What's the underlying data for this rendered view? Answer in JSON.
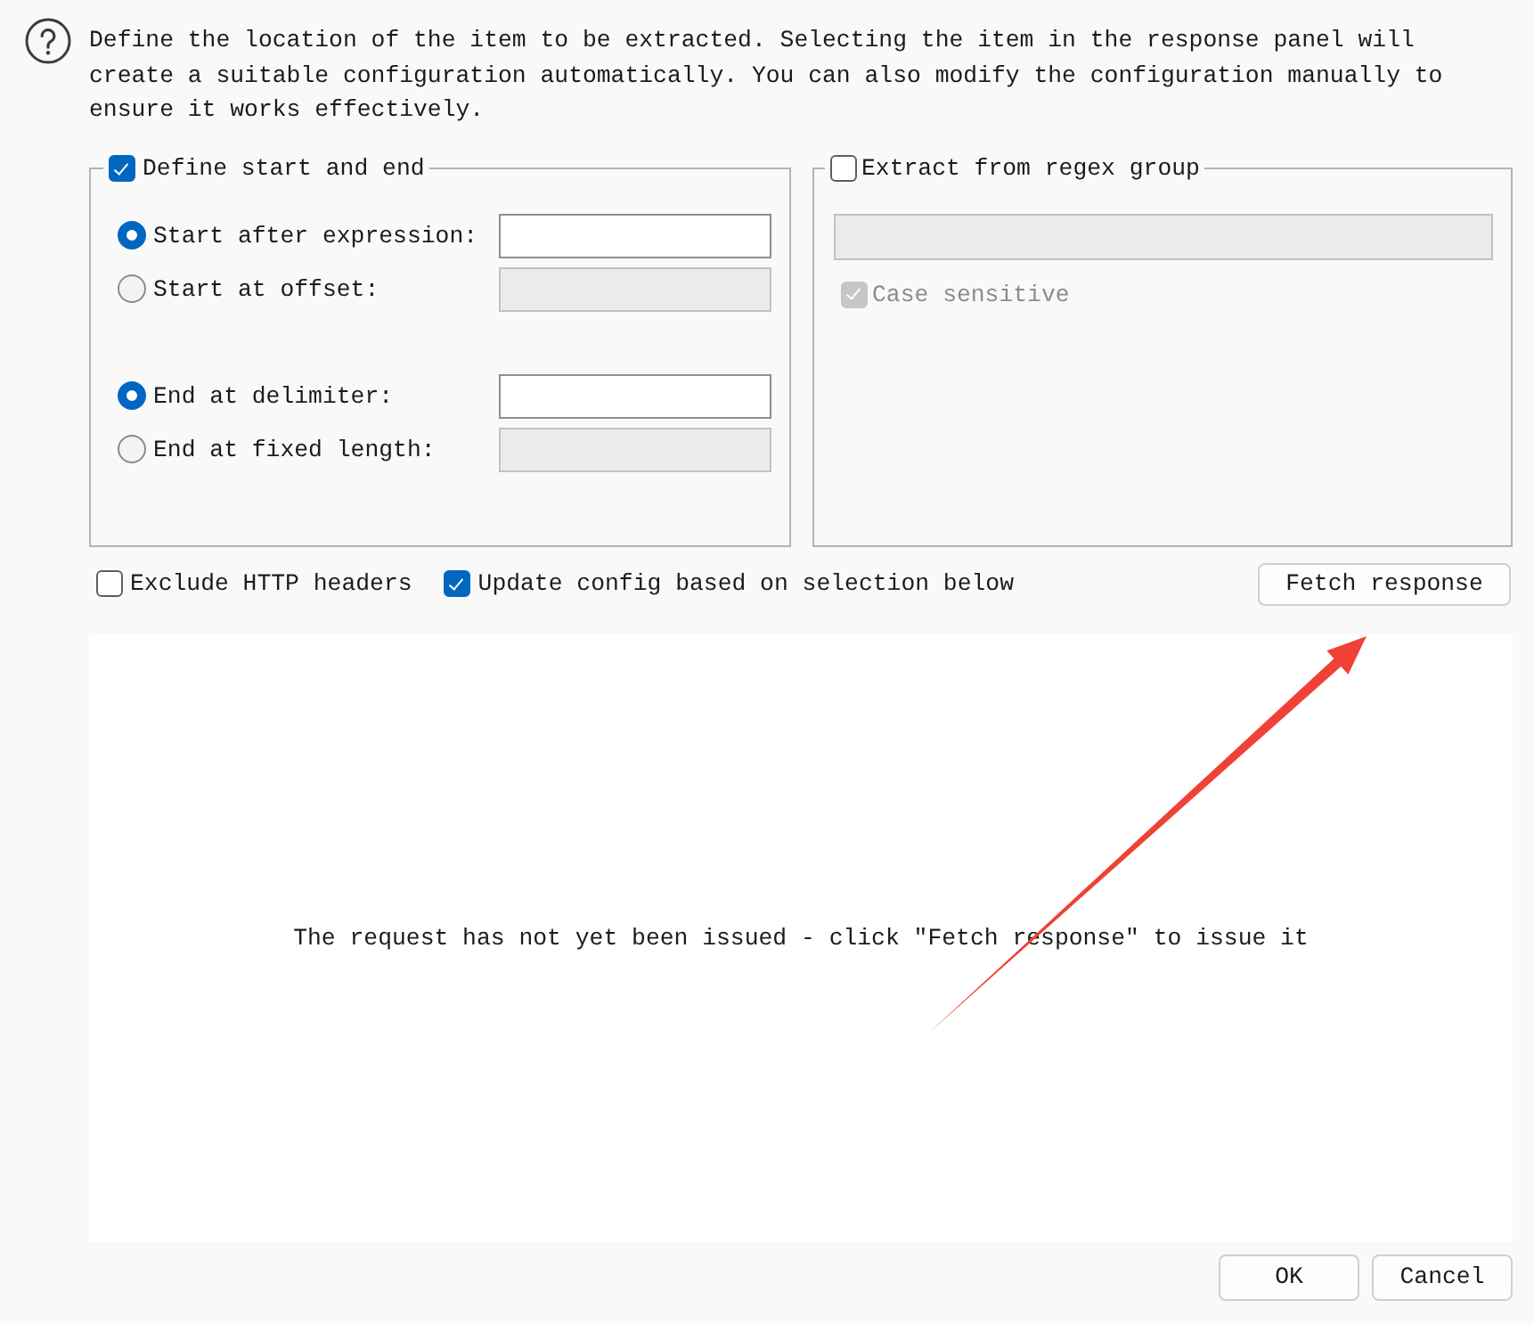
{
  "intro": {
    "text": "Define the location of the item to be extracted. Selecting the item in the response panel will create a suitable configuration automatically. You can also modify the configuration manually to ensure it works effectively."
  },
  "start_end": {
    "label": "Define start and end",
    "checked": true,
    "start_options": [
      {
        "label": "Start after expression:",
        "selected": true,
        "field": {
          "disabled": false
        }
      },
      {
        "label": "Start at offset:",
        "selected": false,
        "field": {
          "disabled": true
        }
      }
    ],
    "end_options": [
      {
        "label": "End at delimiter:",
        "selected": true,
        "field": {
          "disabled": false
        }
      },
      {
        "label": "End at fixed length:",
        "selected": false,
        "field": {
          "disabled": true
        }
      }
    ]
  },
  "regex_group": {
    "label": "Extract from regex group",
    "checked": false,
    "field": {
      "disabled": true
    },
    "case_sensitive": {
      "label": "Case sensitive",
      "checked": true,
      "disabled": true
    }
  },
  "options": [
    {
      "label": "Exclude HTTP headers",
      "checked": false
    },
    {
      "label": "Update config based on selection below",
      "checked": true
    }
  ],
  "fetch_button": {
    "label": "Fetch response"
  },
  "response_panel": {
    "message": "The request has not yet been issued - click \"Fetch response\" to issue it"
  },
  "dialog_buttons": [
    {
      "label": "OK"
    },
    {
      "label": "Cancel"
    }
  ]
}
